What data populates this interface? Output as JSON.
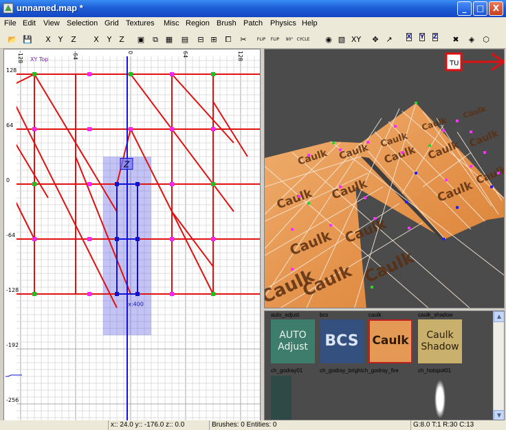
{
  "window": {
    "title": "unnamed.map *"
  },
  "window_controls": {
    "minimize": "_",
    "maximize": "□",
    "close": "X"
  },
  "menu": [
    "File",
    "Edit",
    "View",
    "Selection",
    "Grid",
    "Textures",
    "Misc",
    "Region",
    "Brush",
    "Patch",
    "Physics",
    "Help"
  ],
  "toolbar": {
    "buttons": [
      {
        "name": "open-icon",
        "glyph": "📂"
      },
      {
        "name": "save-icon",
        "glyph": "💾"
      },
      {
        "name": "flip-x-icon",
        "glyph": "X"
      },
      {
        "name": "flip-y-icon",
        "glyph": "Y"
      },
      {
        "name": "flip-z-icon",
        "glyph": "Z"
      },
      {
        "name": "rotate-x-icon",
        "glyph": "X"
      },
      {
        "name": "rotate-y-icon",
        "glyph": "Y"
      },
      {
        "name": "rotate-z-icon",
        "glyph": "Z"
      },
      {
        "name": "select-complete-icon",
        "glyph": "▣"
      },
      {
        "name": "select-touching-icon",
        "glyph": "⧉"
      },
      {
        "name": "select-inside-icon",
        "glyph": "▦"
      },
      {
        "name": "select-partial-icon",
        "glyph": "▤"
      },
      {
        "name": "csg-subtract-icon",
        "glyph": "⊟"
      },
      {
        "name": "csg-merge-icon",
        "glyph": "⊞"
      },
      {
        "name": "hollow-icon",
        "glyph": "⧠"
      },
      {
        "name": "clipper-icon",
        "glyph": "✂"
      },
      {
        "name": "flip-horizontal-icon",
        "glyph": "FLIP"
      },
      {
        "name": "flip-vertical-icon",
        "glyph": "FLIP"
      },
      {
        "name": "texture-rotate-icon",
        "glyph": "90°"
      },
      {
        "name": "cycle-layer-icon",
        "glyph": "CYCLE"
      },
      {
        "name": "camera-icon",
        "glyph": "◉"
      },
      {
        "name": "texture-view-icon",
        "glyph": "▧"
      },
      {
        "name": "xy-view-icon",
        "glyph": "XY"
      },
      {
        "name": "rotate-mode-icon",
        "glyph": "✥"
      },
      {
        "name": "scale-mode-icon",
        "glyph": "↗"
      },
      {
        "name": "axis-x-icon",
        "glyph": "X"
      },
      {
        "name": "axis-y-icon",
        "glyph": "Y"
      },
      {
        "name": "axis-z-icon",
        "glyph": "Z"
      },
      {
        "name": "no-patch-icon",
        "glyph": "✖"
      },
      {
        "name": "patch-tool-icon",
        "glyph": "◈"
      },
      {
        "name": "cap-icon",
        "glyph": "⬡"
      }
    ]
  },
  "view2d": {
    "label": "XY Top",
    "h_ruler": [
      "-128",
      "-64",
      "0",
      "64",
      "128"
    ],
    "v_ruler": [
      "128",
      "64",
      "0",
      "-64",
      "-128",
      "-192",
      "-256"
    ],
    "size_label": "x:400",
    "origin_marker": "Z"
  },
  "view3d": {
    "texture_label": "Caulk",
    "widget_label": "TU",
    "colors": {
      "surface": "#e0904a",
      "background": "#4b4b4b"
    }
  },
  "textures": [
    {
      "name": "auto_adjust",
      "text": "AUTO Adjust",
      "bg": "#3e7d6c",
      "fg": "#e9f6ee"
    },
    {
      "name": "bcs",
      "text": "BCS",
      "bg": "#33507e",
      "fg": "#dce6f6"
    },
    {
      "name": "caulk",
      "text": "Caulk",
      "bg": "#e49a54",
      "fg": "#2a1a0a"
    },
    {
      "name": "caulk_shadow",
      "text": "Caulk Shadow",
      "bg": "#c9b06c",
      "fg": "#2a200a"
    },
    {
      "name": "ch_godray01",
      "text": "",
      "bg": "#2f4a46",
      "fg": "#fff"
    },
    {
      "name": "ch_godray_brightch_godray_fire",
      "text": "",
      "bg": "#4b4b4b",
      "fg": "#fff"
    },
    {
      "name": "ch_hotspot01",
      "text": "",
      "bg": "#4b4b4b",
      "fg": "#fff"
    }
  ],
  "status": {
    "coords": "x:: 24.0  y:: -176.0  z:: 0.0",
    "counts": "Brushes: 0 Entities: 0",
    "grid": "G:8.0 T:1 R:30 C:13"
  }
}
